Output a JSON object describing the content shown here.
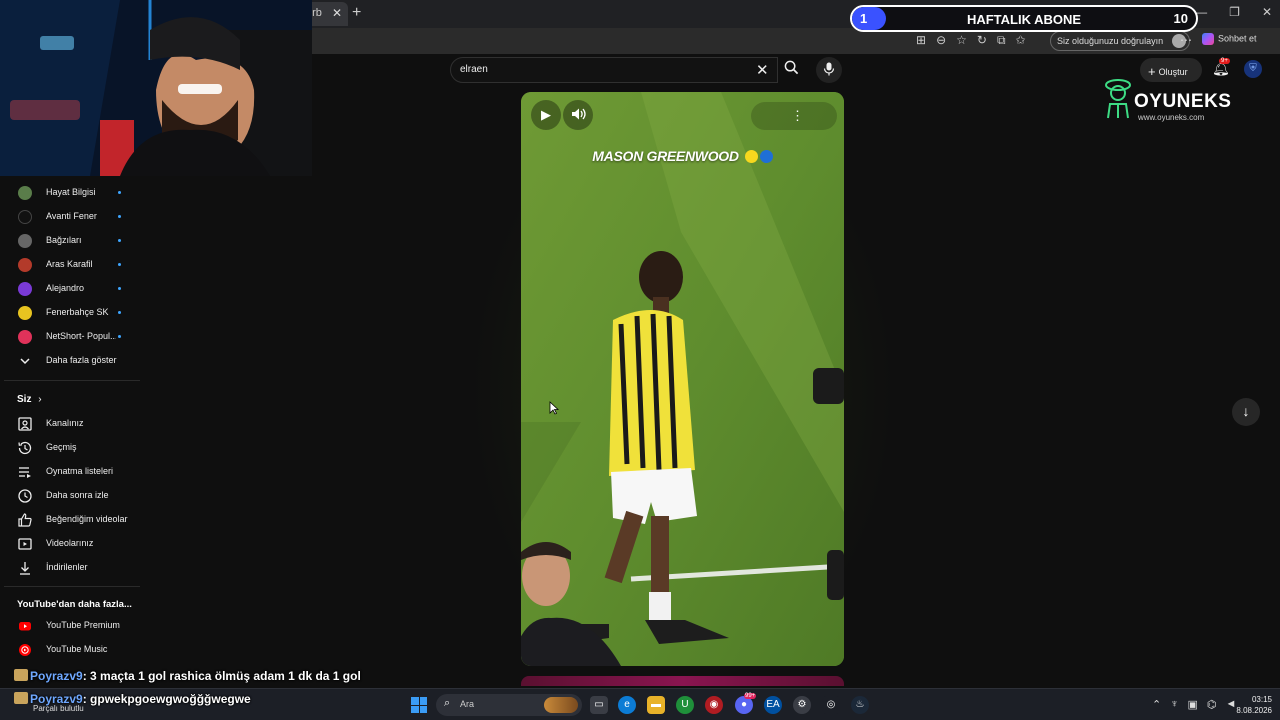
{
  "browser": {
    "tab_label": "erb",
    "tab_close": "✕",
    "new_tab": "+",
    "window_controls": [
      "—",
      "❐",
      "✕"
    ],
    "verify_label": "Siz olduğunuzu doğrulayın",
    "more": "⋯",
    "chat_label": "Sohbet et"
  },
  "weekly_goal": {
    "current": "1",
    "title": "HAFTALIK ABONE",
    "goal": "10",
    "progress": 0.1,
    "fill_color": "#3a52ff"
  },
  "youtube": {
    "search_value": "elraen",
    "create_label": "Oluştur",
    "notification_badge": "9+"
  },
  "logo": {
    "name": "OYUNEKS",
    "url": "www.oyuneks.com"
  },
  "sidebar": {
    "subscriptions": [
      {
        "label": "Hayat Bilgisi",
        "color": "#5a7d4a"
      },
      {
        "label": "Avanti Fener",
        "color": "#111111"
      },
      {
        "label": "Bağzıları",
        "color": "#666666"
      },
      {
        "label": "Aras Karafil",
        "color": "#b33a2a"
      },
      {
        "label": "Alejandro",
        "color": "#7a3ad6"
      },
      {
        "label": "Fenerbahçe SK",
        "color": "#e8c420"
      },
      {
        "label": "NetShort- Popul...",
        "color": "#e0325a"
      }
    ],
    "show_more": "Daha fazla göster",
    "you_heading": "Siz",
    "you_items": [
      {
        "label": "Kanalınız",
        "icon": "channel-icon"
      },
      {
        "label": "Geçmiş",
        "icon": "history-icon"
      },
      {
        "label": "Oynatma listeleri",
        "icon": "playlist-icon"
      },
      {
        "label": "Daha sonra izle",
        "icon": "watch-later-icon"
      },
      {
        "label": "Beğendiğim videolar",
        "icon": "like-icon"
      },
      {
        "label": "Videolarınız",
        "icon": "your-videos-icon"
      },
      {
        "label": "İndirilenler",
        "icon": "download-icon"
      }
    ],
    "more_heading": "YouTube'dan daha fazla...",
    "more_items": [
      {
        "label": "YouTube Premium",
        "color": "#ff0000"
      },
      {
        "label": "YouTube Music",
        "color": "#ff0000"
      }
    ]
  },
  "short": {
    "title": "MASON GREENWOOD"
  },
  "chat": [
    {
      "user": "Poyrazv9",
      "message": ": 3 maçta 1 gol rashica ölmüş adam 1 dk da 1 gol"
    },
    {
      "user": "Poyrazv9",
      "message": ": gpwekpgoewgwoğğğwegwe"
    }
  ],
  "weather": "Parçalı bulutlu",
  "taskbar": {
    "search_placeholder": "Ara",
    "time": "03:15",
    "date": "8.08.2026",
    "app_badge": "99+"
  }
}
